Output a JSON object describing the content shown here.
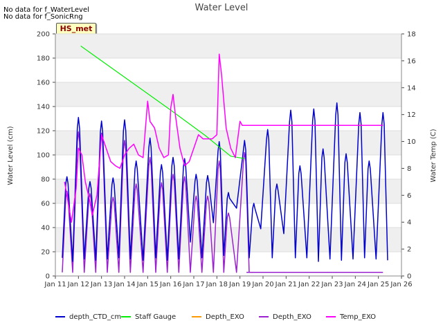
{
  "notes": [
    "No data for f_WaterLevel",
    "No data for f_SonicRng"
  ],
  "badge": "HS_met",
  "chart_data": {
    "type": "line",
    "title": "Water Level",
    "xlabel": "",
    "ylabel": "Water Level (cm)",
    "y2label": "Water Temp (C)",
    "xlim": [
      11,
      26
    ],
    "ylim": [
      0,
      200
    ],
    "y2lim": [
      0,
      18
    ],
    "x_ticks": [
      "Jan 11",
      "Jan 12",
      "Jan 13",
      "Jan 14",
      "Jan 15",
      "Jan 16",
      "Jan 17",
      "Jan 18",
      "Jan 19",
      "Jan 20",
      "Jan 21",
      "Jan 22",
      "Jan 23",
      "Jan 24",
      "Jan 25",
      "Jan 26"
    ],
    "y_ticks": [
      0,
      20,
      40,
      60,
      80,
      100,
      120,
      140,
      160,
      180,
      200
    ],
    "y2_ticks": [
      0,
      2,
      4,
      6,
      8,
      10,
      12,
      14,
      16,
      18
    ],
    "legend_position": "bottom",
    "colors": {
      "depth_ctd": "#0000cc",
      "staff": "#00ee00",
      "depth_exo_orange": "#ff9900",
      "depth_exo_purple": "#9a20d0",
      "temp": "#ff00ff"
    },
    "series": [
      {
        "name": "depth_CTD_cm",
        "axis": "left",
        "color": "#0000cc",
        "daily_high_peaks": [
          [
            11.5,
            82
          ],
          [
            12.0,
            131
          ],
          [
            12.5,
            78
          ],
          [
            13.0,
            128
          ],
          [
            13.5,
            81
          ],
          [
            14.0,
            129
          ],
          [
            14.5,
            95
          ],
          [
            15.1,
            114
          ],
          [
            15.6,
            92
          ],
          [
            16.1,
            98
          ],
          [
            16.6,
            97
          ],
          [
            17.1,
            84
          ],
          [
            17.6,
            83
          ],
          [
            18.1,
            111
          ],
          [
            18.5,
            69
          ],
          [
            19.2,
            112
          ],
          [
            19.6,
            60
          ],
          [
            20.2,
            121
          ],
          [
            20.6,
            76
          ],
          [
            21.2,
            137
          ],
          [
            21.6,
            91
          ],
          [
            22.2,
            138
          ],
          [
            22.6,
            105
          ],
          [
            23.2,
            143
          ],
          [
            23.6,
            101
          ],
          [
            24.2,
            135
          ],
          [
            24.6,
            95
          ],
          [
            25.2,
            135
          ]
        ],
        "lows": [
          15,
          12,
          14,
          13,
          14,
          15,
          14,
          13,
          15,
          13,
          14,
          28,
          15,
          44,
          17,
          56,
          15,
          39,
          15,
          35,
          15
        ]
      },
      {
        "name": "Staff Gauge",
        "axis": "left",
        "color": "#00ee00",
        "points": [
          [
            12.1,
            190
          ],
          [
            16.0,
            137
          ],
          [
            17.5,
            116
          ],
          [
            18.6,
            99
          ],
          [
            19.2,
            97
          ]
        ]
      },
      {
        "name": "Depth_EXO",
        "axis": "left",
        "color": "#ff9900",
        "points": []
      },
      {
        "name": "Depth_EXO",
        "axis": "left",
        "color": "#9a20d0",
        "daily_high_peaks": [
          [
            11.5,
            70
          ],
          [
            12.0,
            119
          ],
          [
            12.5,
            68
          ],
          [
            13.0,
            118
          ],
          [
            13.5,
            65
          ],
          [
            14.0,
            112
          ],
          [
            14.5,
            76
          ],
          [
            15.1,
            98
          ],
          [
            15.6,
            77
          ],
          [
            16.1,
            84
          ],
          [
            16.6,
            82
          ],
          [
            17.1,
            66
          ],
          [
            17.6,
            66
          ],
          [
            18.1,
            95
          ],
          [
            18.5,
            52
          ],
          [
            19.2,
            102
          ]
        ],
        "flat_after": [
          [
            19.3,
            3
          ],
          [
            25.2,
            3
          ]
        ]
      },
      {
        "name": "Temp_EXO",
        "axis": "right",
        "color": "#ff00ff",
        "points": [
          [
            11.4,
            7.0
          ],
          [
            11.7,
            4.0
          ],
          [
            11.9,
            6.5
          ],
          [
            12.0,
            9.5
          ],
          [
            12.15,
            9.0
          ],
          [
            12.3,
            7.0
          ],
          [
            12.5,
            5.5
          ],
          [
            12.6,
            4.5
          ],
          [
            12.8,
            6.0
          ],
          [
            13.0,
            10.5
          ],
          [
            13.2,
            9.5
          ],
          [
            13.4,
            8.5
          ],
          [
            13.6,
            8.2
          ],
          [
            13.8,
            8.0
          ],
          [
            14.0,
            9.0
          ],
          [
            14.2,
            9.5
          ],
          [
            14.4,
            9.8
          ],
          [
            14.6,
            9.0
          ],
          [
            14.8,
            8.8
          ],
          [
            15.0,
            13.0
          ],
          [
            15.1,
            11.5
          ],
          [
            15.3,
            11.0
          ],
          [
            15.5,
            9.5
          ],
          [
            15.7,
            8.8
          ],
          [
            15.9,
            9.0
          ],
          [
            16.0,
            12.5
          ],
          [
            16.1,
            13.5
          ],
          [
            16.2,
            12.0
          ],
          [
            16.4,
            9.5
          ],
          [
            16.6,
            8.2
          ],
          [
            16.8,
            8.5
          ],
          [
            17.0,
            9.5
          ],
          [
            17.2,
            10.5
          ],
          [
            17.4,
            10.2
          ],
          [
            17.6,
            10.2
          ],
          [
            17.8,
            10.2
          ],
          [
            18.0,
            10.5
          ],
          [
            18.1,
            16.5
          ],
          [
            18.2,
            15.0
          ],
          [
            18.4,
            11.0
          ],
          [
            18.6,
            9.5
          ],
          [
            18.8,
            8.8
          ],
          [
            19.0,
            11.5
          ],
          [
            19.1,
            11.2
          ],
          [
            25.2,
            11.2
          ]
        ]
      }
    ],
    "legend": [
      {
        "label": "depth_CTD_cm",
        "color": "#0000cc"
      },
      {
        "label": "Staff Gauge",
        "color": "#00ee00"
      },
      {
        "label": "Depth_EXO",
        "color": "#ff9900"
      },
      {
        "label": "Depth_EXO",
        "color": "#9a20d0"
      },
      {
        "label": "Temp_EXO",
        "color": "#ff00ff"
      }
    ]
  }
}
